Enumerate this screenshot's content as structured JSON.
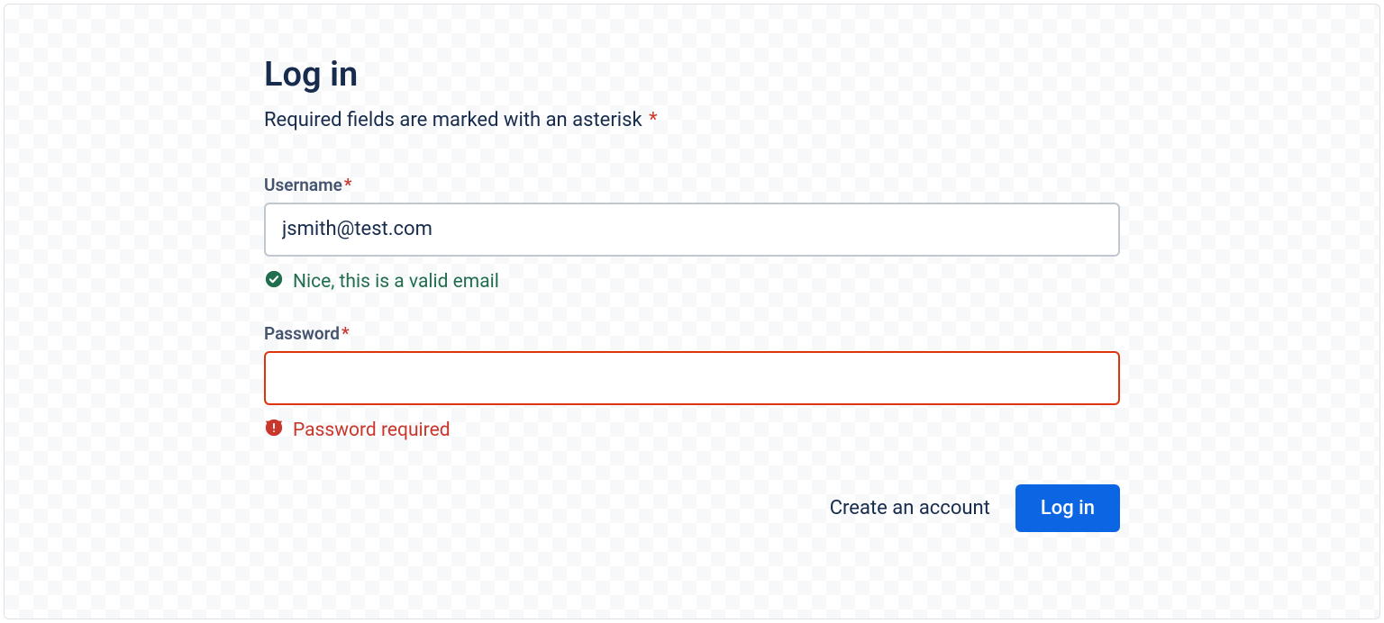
{
  "form": {
    "title": "Log in",
    "subtitle": "Required fields are marked with an asterisk",
    "asterisk": "*"
  },
  "fields": {
    "username": {
      "label": "Username",
      "required_mark": "*",
      "value": "jsmith@test.com",
      "validation_state": "success",
      "validation_message": "Nice, this is a valid email"
    },
    "password": {
      "label": "Password",
      "required_mark": "*",
      "value": "",
      "validation_state": "error",
      "validation_message": "Password required"
    }
  },
  "actions": {
    "secondary_link": "Create an account",
    "primary_button": "Log in"
  },
  "colors": {
    "text_primary": "#172B4D",
    "text_subtle": "#44546F",
    "danger": "#C9372C",
    "danger_border": "#DE350B",
    "success": "#216E4E",
    "brand": "#0C66E4",
    "border": "#C1C7D0"
  }
}
